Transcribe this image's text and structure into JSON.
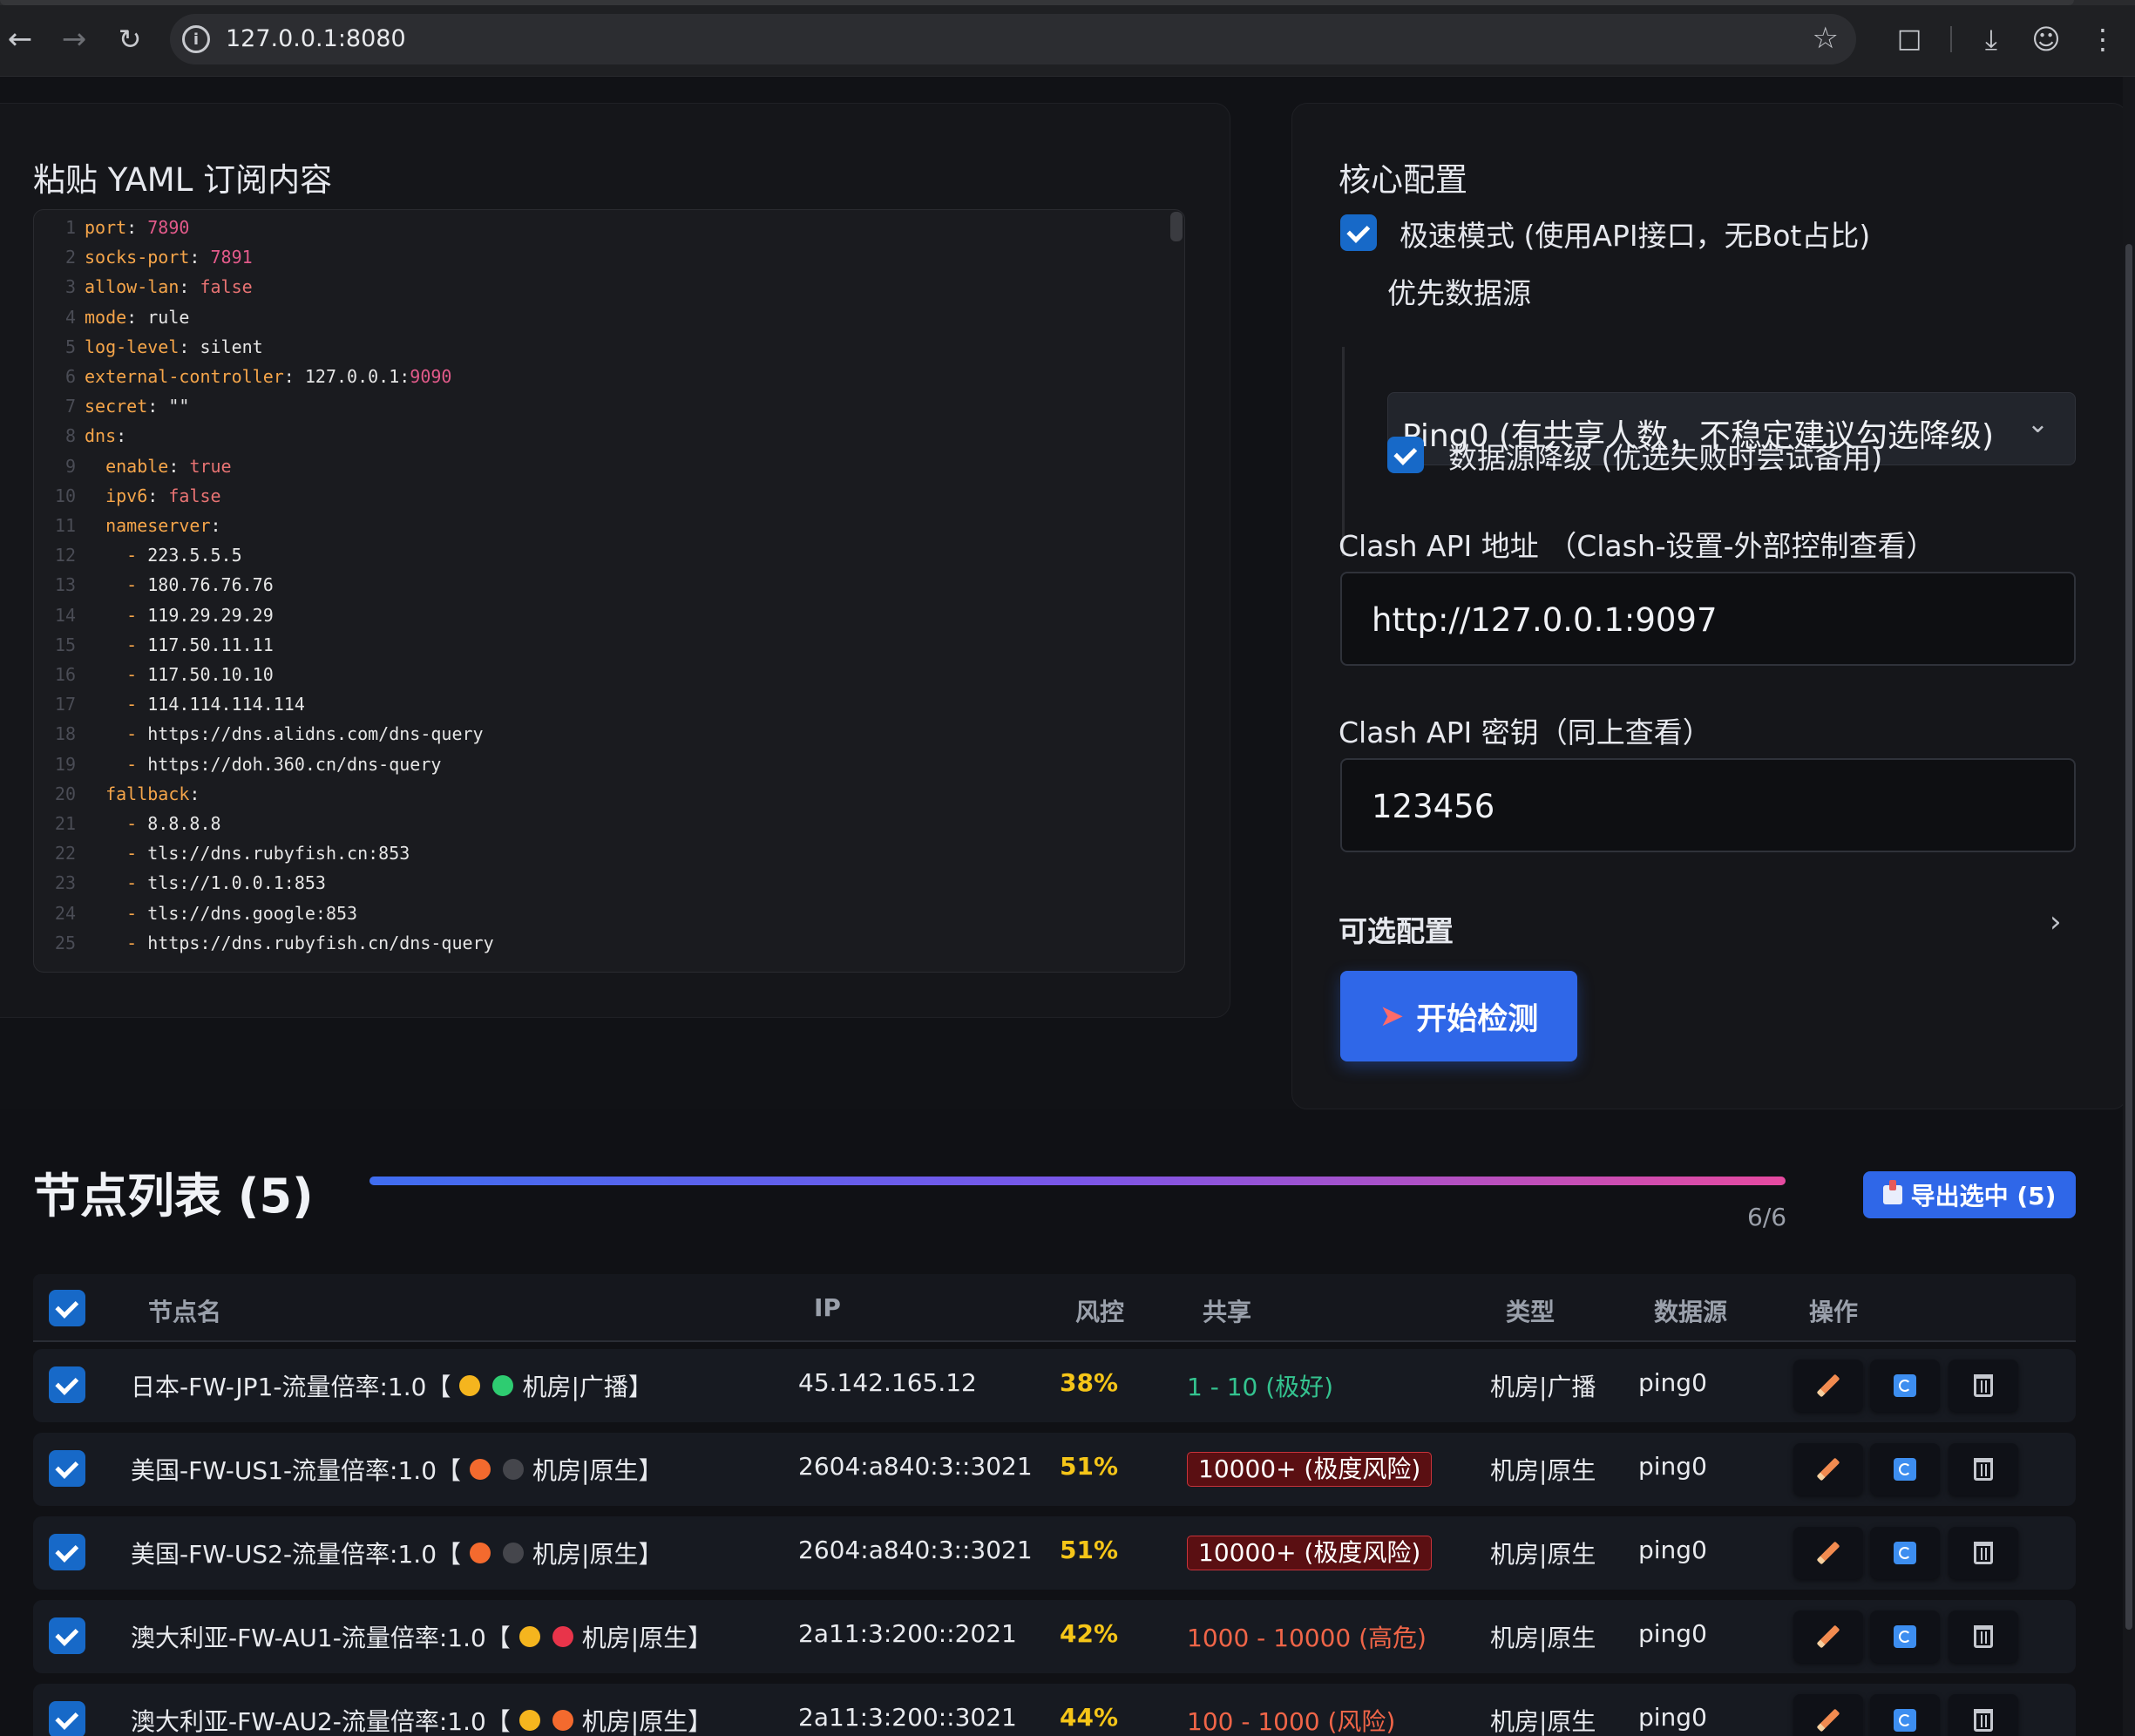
{
  "browser": {
    "url": "127.0.0.1:8080"
  },
  "editor": {
    "title": "粘贴 YAML 订阅内容",
    "lines": [
      {
        "n": "1",
        "parts": [
          [
            "k",
            "port"
          ],
          [
            "t",
            ": "
          ],
          [
            "n",
            "7890"
          ]
        ]
      },
      {
        "n": "2",
        "parts": [
          [
            "k",
            "socks-port"
          ],
          [
            "t",
            ": "
          ],
          [
            "n",
            "7891"
          ]
        ]
      },
      {
        "n": "3",
        "parts": [
          [
            "k",
            "allow-lan"
          ],
          [
            "t",
            ": "
          ],
          [
            "b",
            "false"
          ]
        ]
      },
      {
        "n": "4",
        "parts": [
          [
            "k",
            "mode"
          ],
          [
            "t",
            ": rule"
          ]
        ]
      },
      {
        "n": "5",
        "parts": [
          [
            "k",
            "log-level"
          ],
          [
            "t",
            ": silent"
          ]
        ]
      },
      {
        "n": "6",
        "parts": [
          [
            "k",
            "external-controller"
          ],
          [
            "t",
            ": 127.0.0.1:"
          ],
          [
            "n",
            "9090"
          ]
        ]
      },
      {
        "n": "7",
        "parts": [
          [
            "k",
            "secret"
          ],
          [
            "t",
            ": \"\""
          ]
        ]
      },
      {
        "n": "8",
        "parts": [
          [
            "k",
            "dns"
          ],
          [
            "t",
            ":"
          ]
        ]
      },
      {
        "n": "9",
        "parts": [
          [
            "t",
            "  "
          ],
          [
            "k",
            "enable"
          ],
          [
            "t",
            ": "
          ],
          [
            "b",
            "true"
          ]
        ]
      },
      {
        "n": "10",
        "parts": [
          [
            "t",
            "  "
          ],
          [
            "k",
            "ipv6"
          ],
          [
            "t",
            ": "
          ],
          [
            "b",
            "false"
          ]
        ]
      },
      {
        "n": "11",
        "parts": [
          [
            "t",
            "  "
          ],
          [
            "k",
            "nameserver"
          ],
          [
            "t",
            ":"
          ]
        ]
      },
      {
        "n": "12",
        "parts": [
          [
            "t",
            "    "
          ],
          [
            "d",
            "- "
          ],
          [
            "t",
            "223.5.5.5"
          ]
        ]
      },
      {
        "n": "13",
        "parts": [
          [
            "t",
            "    "
          ],
          [
            "d",
            "- "
          ],
          [
            "t",
            "180.76.76.76"
          ]
        ]
      },
      {
        "n": "14",
        "parts": [
          [
            "t",
            "    "
          ],
          [
            "d",
            "- "
          ],
          [
            "t",
            "119.29.29.29"
          ]
        ]
      },
      {
        "n": "15",
        "parts": [
          [
            "t",
            "    "
          ],
          [
            "d",
            "- "
          ],
          [
            "t",
            "117.50.11.11"
          ]
        ]
      },
      {
        "n": "16",
        "parts": [
          [
            "t",
            "    "
          ],
          [
            "d",
            "- "
          ],
          [
            "t",
            "117.50.10.10"
          ]
        ]
      },
      {
        "n": "17",
        "parts": [
          [
            "t",
            "    "
          ],
          [
            "d",
            "- "
          ],
          [
            "t",
            "114.114.114.114"
          ]
        ]
      },
      {
        "n": "18",
        "parts": [
          [
            "t",
            "    "
          ],
          [
            "d",
            "- "
          ],
          [
            "t",
            "https://dns.alidns.com/dns-query"
          ]
        ]
      },
      {
        "n": "19",
        "parts": [
          [
            "t",
            "    "
          ],
          [
            "d",
            "- "
          ],
          [
            "t",
            "https://doh.360.cn/dns-query"
          ]
        ]
      },
      {
        "n": "20",
        "parts": [
          [
            "t",
            "  "
          ],
          [
            "k",
            "fallback"
          ],
          [
            "t",
            ":"
          ]
        ]
      },
      {
        "n": "21",
        "parts": [
          [
            "t",
            "    "
          ],
          [
            "d",
            "- "
          ],
          [
            "t",
            "8.8.8.8"
          ]
        ]
      },
      {
        "n": "22",
        "parts": [
          [
            "t",
            "    "
          ],
          [
            "d",
            "- "
          ],
          [
            "t",
            "tls://dns.rubyfish.cn:853"
          ]
        ]
      },
      {
        "n": "23",
        "parts": [
          [
            "t",
            "    "
          ],
          [
            "d",
            "- "
          ],
          [
            "t",
            "tls://1.0.0.1:853"
          ]
        ]
      },
      {
        "n": "24",
        "parts": [
          [
            "t",
            "    "
          ],
          [
            "d",
            "- "
          ],
          [
            "t",
            "tls://dns.google:853"
          ]
        ]
      },
      {
        "n": "25",
        "parts": [
          [
            "t",
            "    "
          ],
          [
            "d",
            "- "
          ],
          [
            "t",
            "https://dns.rubyfish.cn/dns-query"
          ]
        ]
      }
    ]
  },
  "config": {
    "title": "核心配置",
    "fast_mode_label": "极速模式 (使用API接口，无Bot占比)",
    "fast_mode_checked": true,
    "datasource_label": "优先数据源",
    "datasource_value": "Ping0 (有共享人数，不稳定建议勾选降级)",
    "fallback_label": "数据源降级 (优选失败时尝试备用)",
    "fallback_checked": true,
    "api_url_label": "Clash API 地址 （Clash-设置-外部控制查看）",
    "api_url_value": "http://127.0.0.1:9097",
    "api_secret_label": "Clash API 密钥（同上查看）",
    "api_secret_value": "123456",
    "optional_label": "可选配置",
    "start_button": "开始检测"
  },
  "nodes": {
    "title": "节点列表 (5)",
    "progress_text": "6/6",
    "progress_fraction": 1.0,
    "export_button": "导出选中 (5)",
    "headers": {
      "name": "节点名",
      "ip": "IP",
      "risk": "风控",
      "share": "共享",
      "type": "类型",
      "source": "数据源",
      "action": "操作"
    },
    "rows": [
      {
        "name_prefix": "日本-FW-JP1-流量倍率:1.0【",
        "dot1": "#f5b51e",
        "dot2": "#2ecc71",
        "name_suffix": "机房|广播】",
        "ip": "45.142.165.12",
        "risk": "38%",
        "share": "1 - 10 (极好)",
        "share_style": "good",
        "type": "机房|广播",
        "source": "ping0"
      },
      {
        "name_prefix": "美国-FW-US1-流量倍率:1.0【",
        "dot1": "#f46a2e",
        "dot2": "#45464c",
        "name_suffix": "机房|原生】",
        "ip": "2604:a840:3::3021",
        "risk": "51%",
        "share": "10000+ (极度风险)",
        "share_style": "badge",
        "type": "机房|原生",
        "source": "ping0"
      },
      {
        "name_prefix": "美国-FW-US2-流量倍率:1.0【",
        "dot1": "#f46a2e",
        "dot2": "#45464c",
        "name_suffix": "机房|原生】",
        "ip": "2604:a840:3::3021",
        "risk": "51%",
        "share": "10000+ (极度风险)",
        "share_style": "badge",
        "type": "机房|原生",
        "source": "ping0"
      },
      {
        "name_prefix": "澳大利亚-FW-AU1-流量倍率:1.0【",
        "dot1": "#f5b51e",
        "dot2": "#e8344a",
        "name_suffix": "机房|原生】",
        "ip": "2a11:3:200::2021",
        "risk": "42%",
        "share": "1000 - 10000 (高危)",
        "share_style": "danger",
        "type": "机房|原生",
        "source": "ping0"
      },
      {
        "name_prefix": "澳大利亚-FW-AU2-流量倍率:1.0【",
        "dot1": "#f5b51e",
        "dot2": "#f46a2e",
        "name_suffix": "机房|原生】",
        "ip": "2a11:3:200::3021",
        "risk": "44%",
        "share": "100 - 1000 (风险)",
        "share_style": "danger",
        "type": "机房|原生",
        "source": "ping0"
      }
    ]
  }
}
